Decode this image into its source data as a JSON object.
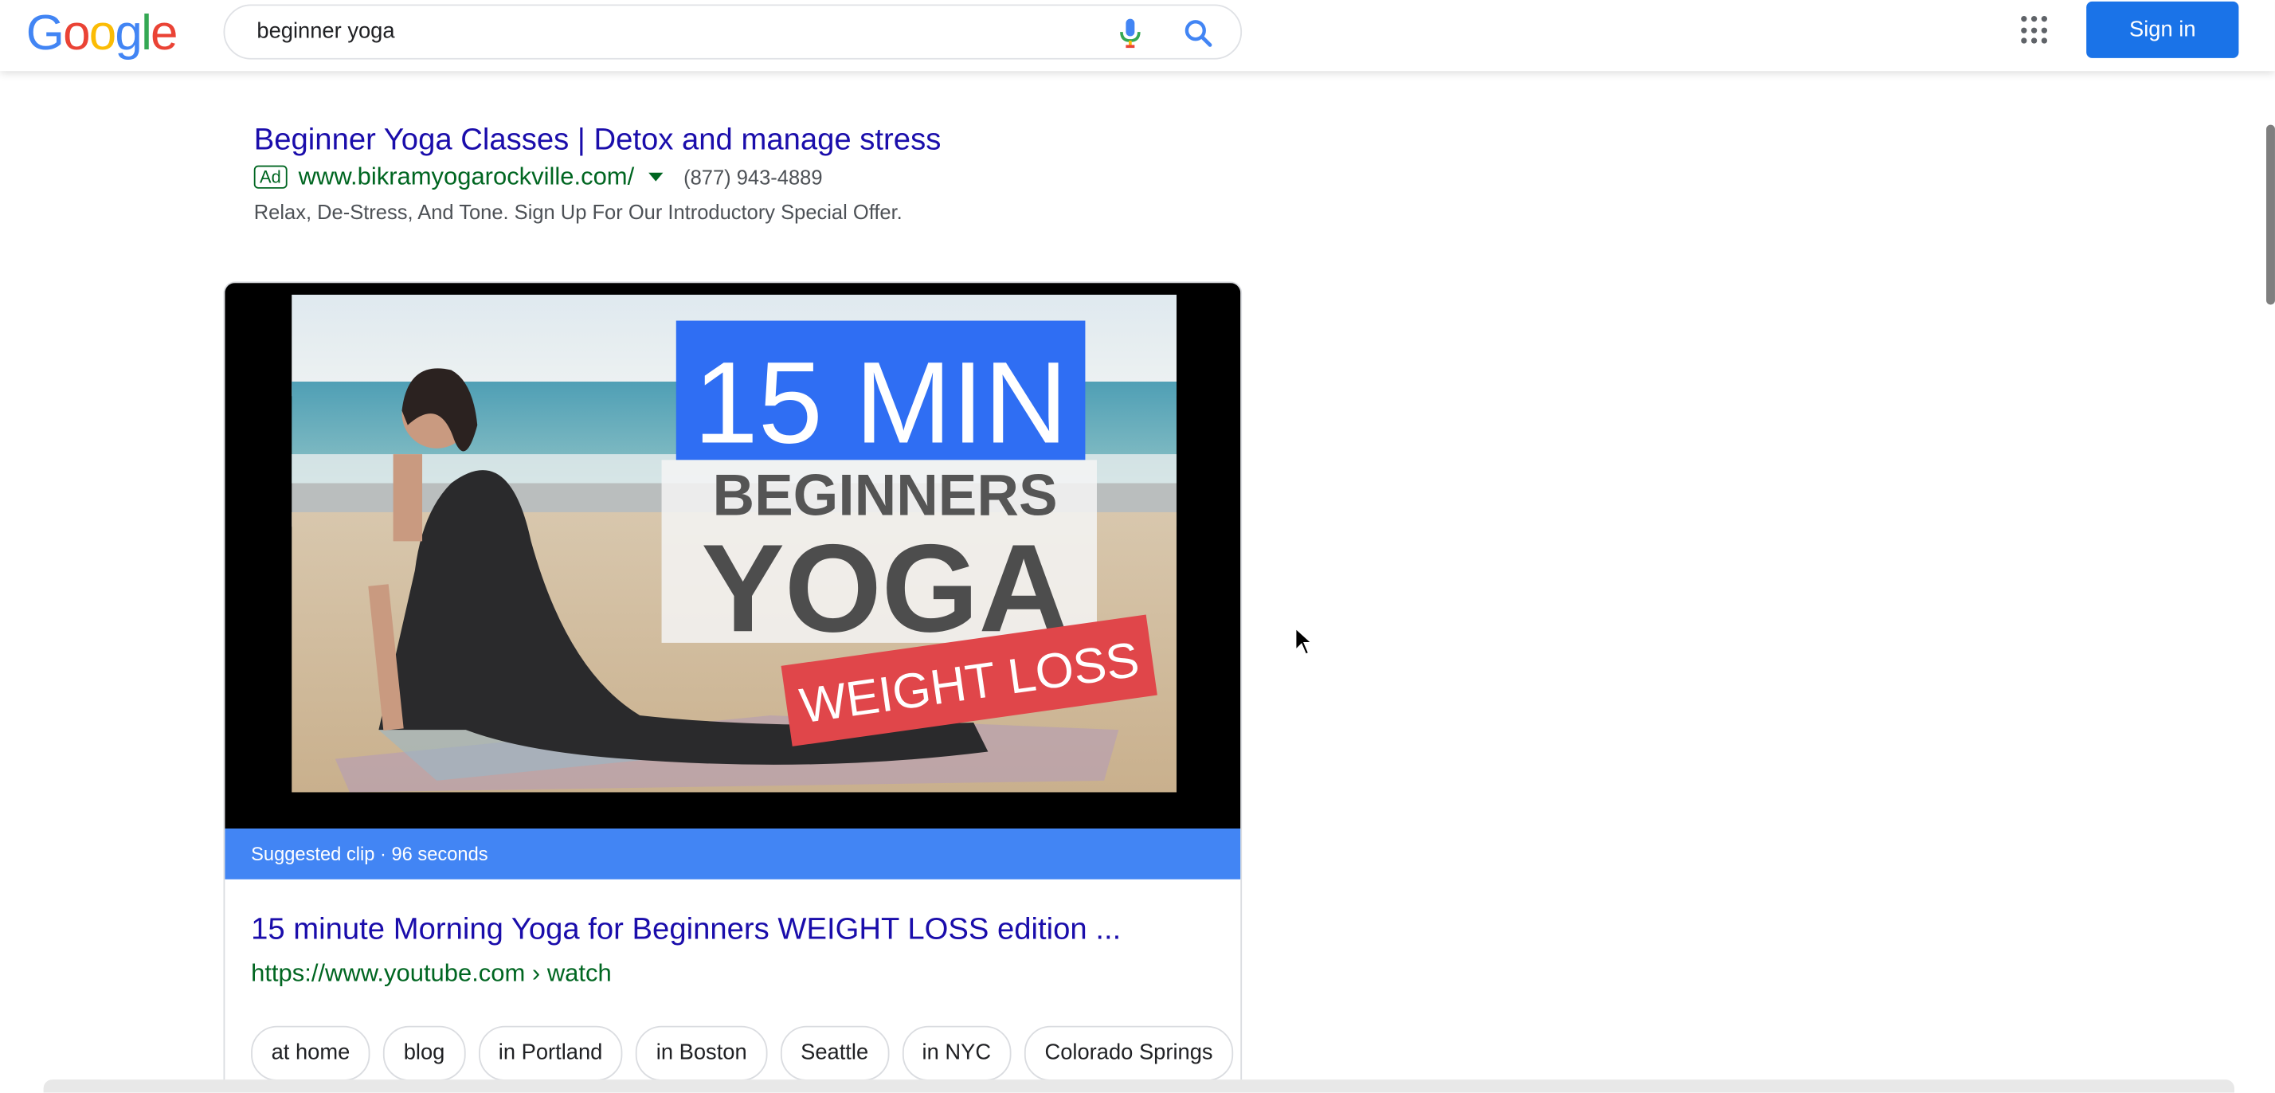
{
  "header": {
    "logo_letters": [
      "G",
      "o",
      "o",
      "g",
      "l",
      "e"
    ],
    "logo_colors": [
      "#4285f4",
      "#ea4335",
      "#fbbc05",
      "#4285f4",
      "#34a853",
      "#ea4335"
    ],
    "search_value": "beginner yoga",
    "signin_label": "Sign in"
  },
  "ad": {
    "title": "Beginner Yoga Classes | Detox and manage stress",
    "badge": "Ad",
    "url": "www.bikramyogarockville.com/",
    "phone": "(877) 943-4889",
    "description": "Relax, De-Stress, And Tone. Sign Up For Our Introductory Special Offer."
  },
  "video": {
    "thumb_line1": "15 MIN",
    "thumb_line2": "BEGINNERS",
    "thumb_line3": "YOGA",
    "thumb_line4": "WEIGHT LOSS",
    "clip_label": "Suggested clip · 96 seconds",
    "title": "15 minute Morning Yoga for Beginners WEIGHT LOSS edition ...",
    "url": "https://www.youtube.com › watch"
  },
  "chips": [
    "at home",
    "blog",
    "in Portland",
    "in Boston",
    "Seattle",
    "in NYC",
    "Colorado Springs"
  ],
  "colors": {
    "link": "#1a0dab",
    "green": "#006621",
    "accent": "#1a73e8",
    "clip_bar": "#4285f4"
  }
}
